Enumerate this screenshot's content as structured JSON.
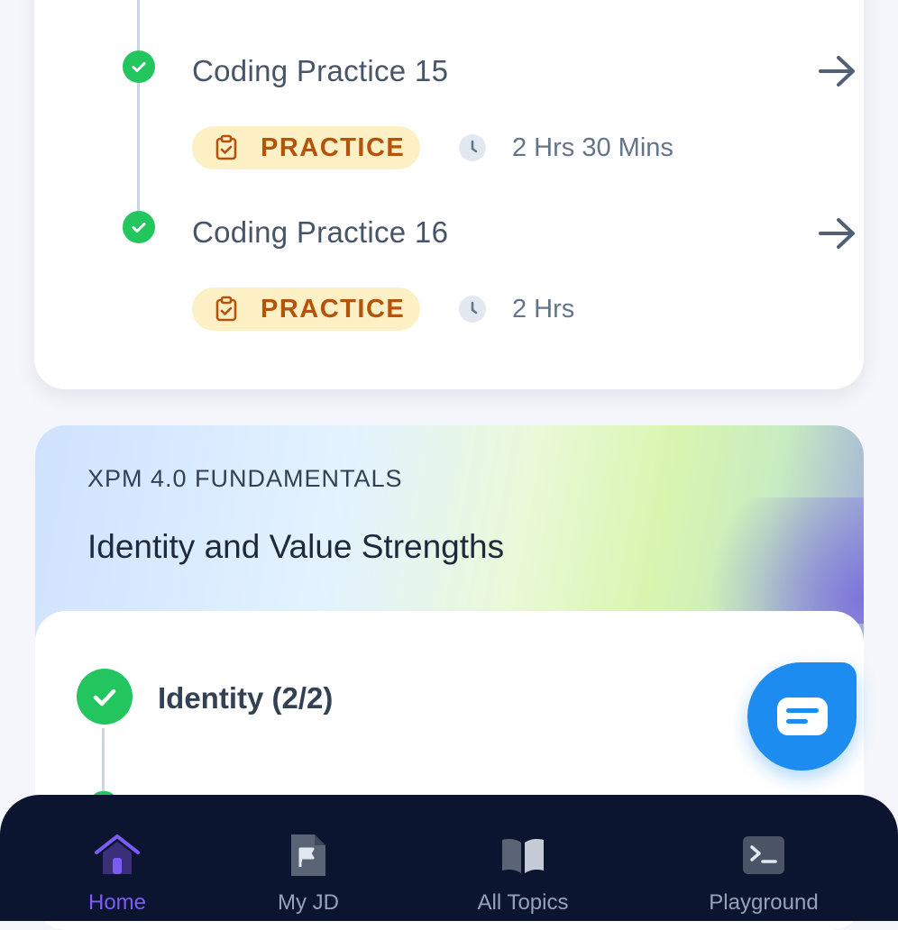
{
  "lessons": [
    {
      "title": "Coding Practice 15",
      "badge": "PRACTICE",
      "duration": "2 Hrs 30 Mins"
    },
    {
      "title": "Coding Practice 16",
      "badge": "PRACTICE",
      "duration": "2 Hrs"
    }
  ],
  "module": {
    "eyebrow": "XPM 4.0 FUNDAMENTALS",
    "title": "Identity and Value Strengths",
    "items": [
      {
        "label": "Identity (2/2)"
      }
    ]
  },
  "bottom_nav": {
    "items": [
      {
        "label": "Home",
        "icon": "home-icon",
        "active": true
      },
      {
        "label": "My JD",
        "icon": "flag-file-icon",
        "active": false
      },
      {
        "label": "All Topics",
        "icon": "book-icon",
        "active": false
      },
      {
        "label": "Playground",
        "icon": "terminal-icon",
        "active": false
      }
    ]
  },
  "colors": {
    "accent": "#7c5cf5",
    "success": "#22c55e",
    "badge_bg": "#fdf0c4",
    "badge_text": "#b45309",
    "chat": "#1d8cf0",
    "nav_bg": "#0b1530"
  }
}
